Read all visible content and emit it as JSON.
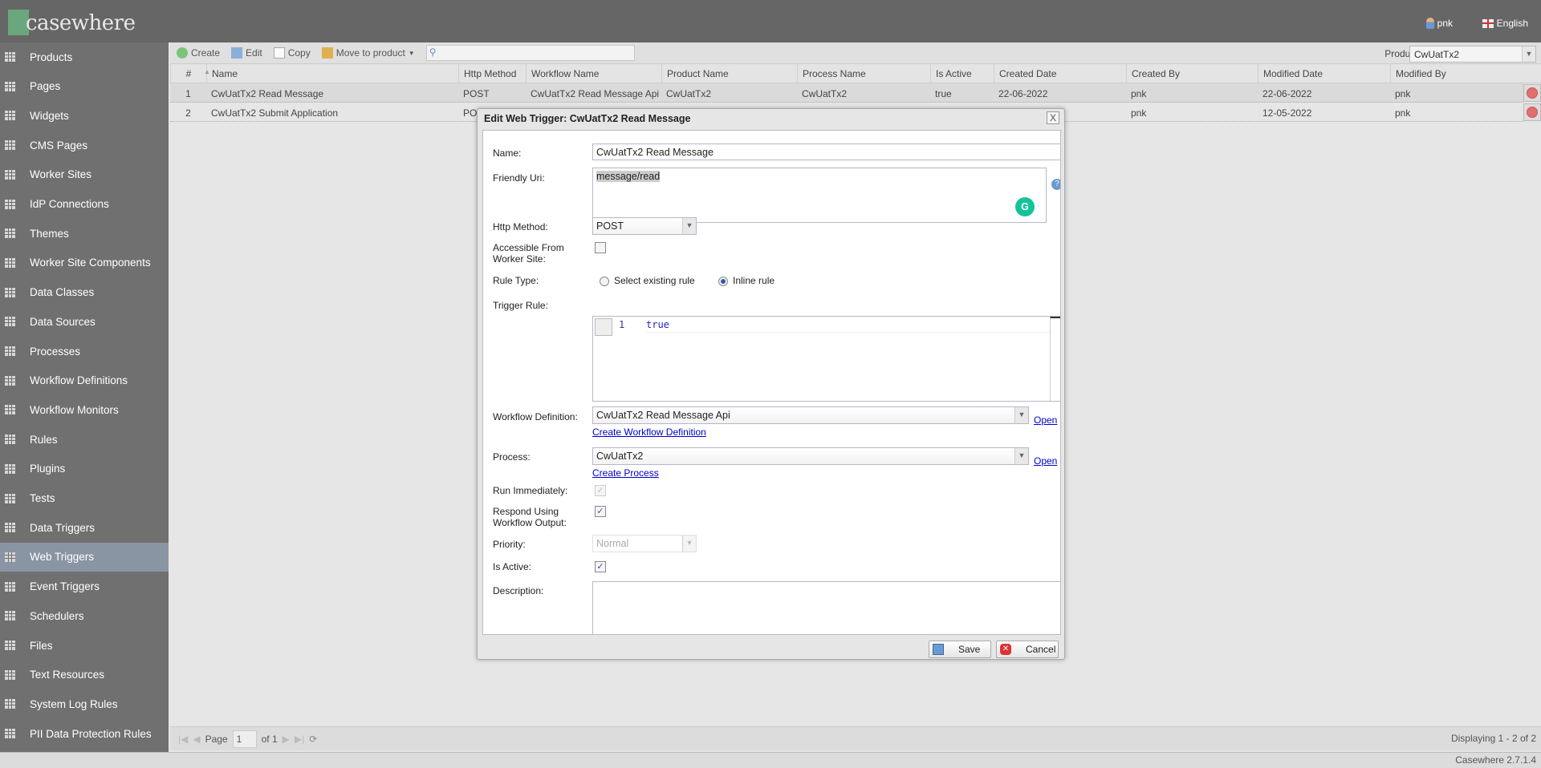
{
  "app": {
    "logo": "casewhere",
    "user": "pnk",
    "language": "English",
    "version": "Casewhere 2.7.1.4"
  },
  "sidebar": {
    "selected": "Web Triggers",
    "items": [
      "Products",
      "Pages",
      "Widgets",
      "CMS Pages",
      "Worker Sites",
      "IdP Connections",
      "Themes",
      "Worker Site Components",
      "Data Classes",
      "Data Sources",
      "Processes",
      "Workflow Definitions",
      "Workflow Monitors",
      "Rules",
      "Plugins",
      "Tests",
      "Data Triggers",
      "Web Triggers",
      "Event Triggers",
      "Schedulers",
      "Files",
      "Text Resources",
      "System Log Rules",
      "PII Data Protection Rules"
    ]
  },
  "toolbar": {
    "create": "Create",
    "edit": "Edit",
    "copy": "Copy",
    "move": "Move to product",
    "search_value": "",
    "product_label": "Product:",
    "product_value": "CwUatTx2"
  },
  "grid": {
    "columns": [
      "#",
      "Name",
      "Http Method",
      "Workflow Name",
      "Product Name",
      "Process Name",
      "Is Active",
      "Created Date",
      "Created By",
      "Modified Date",
      "Modified By"
    ],
    "rows": [
      [
        "1",
        "CwUatTx2 Read Message",
        "POST",
        "CwUatTx2 Read Message Api",
        "CwUatTx2",
        "CwUatTx2",
        "true",
        "22-06-2022",
        "pnk",
        "22-06-2022",
        "pnk"
      ],
      [
        "2",
        "CwUatTx2 Submit Application",
        "POST",
        "",
        "",
        "",
        "",
        "",
        "pnk",
        "12-05-2022",
        "pnk"
      ]
    ]
  },
  "pager": {
    "page_label": "Page",
    "page": "1",
    "of": "of 1",
    "displaying": "Displaying 1 - 2 of 2"
  },
  "dialog": {
    "title": "Edit Web Trigger: CwUatTx2 Read Message",
    "close": "X",
    "name_label": "Name:",
    "name_value": "CwUatTx2 Read Message",
    "uri_label": "Friendly Uri:",
    "uri_value": "message/read",
    "method_label": "Http Method:",
    "method_value": "POST",
    "accessible_label": "Accessible From Worker Site:",
    "accessible_checked": false,
    "rule_type_label": "Rule Type:",
    "rule_opt1": "Select existing rule",
    "rule_opt2": "Inline rule",
    "rule_type_selected": "Inline rule",
    "trigger_label": "Trigger Rule:",
    "code_line": "1",
    "code": "true",
    "wf_label": "Workflow Definition:",
    "wf_value": "CwUatTx2 Read Message Api",
    "open": "Open",
    "create_wf": "Create Workflow Definition",
    "process_label": "Process:",
    "process_value": "CwUatTx2",
    "create_process": "Create Process",
    "run_label": "Run Immediately:",
    "run_checked": true,
    "respond_label": "Respond Using Workflow Output:",
    "respond_checked": true,
    "priority_label": "Priority:",
    "priority_value": "Normal",
    "active_label": "Is Active:",
    "active_checked": true,
    "desc_label": "Description:",
    "desc_value": "",
    "save": "Save",
    "cancel": "Cancel"
  }
}
